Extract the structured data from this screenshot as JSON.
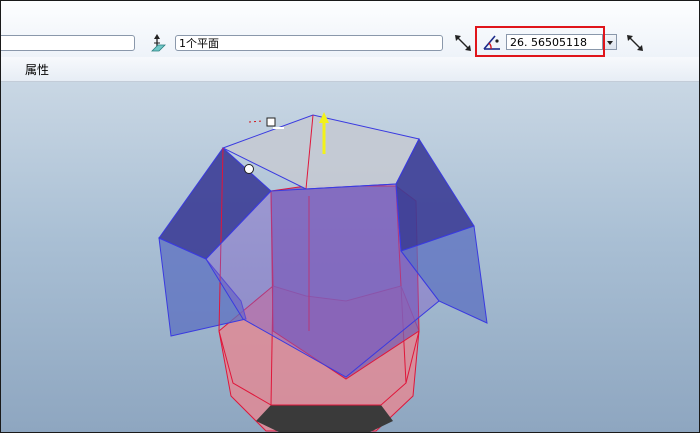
{
  "toolbar": {
    "plane_reference": "1个平面",
    "angle_value": "26. 56505118"
  },
  "tabs": {
    "properties": "属性"
  },
  "icons": {
    "flip_left": "flip-arrow-icon",
    "plane_ref": "plane-normal-icon",
    "angle": "angle-icon",
    "flip_right": "flip-arrow-icon"
  }
}
